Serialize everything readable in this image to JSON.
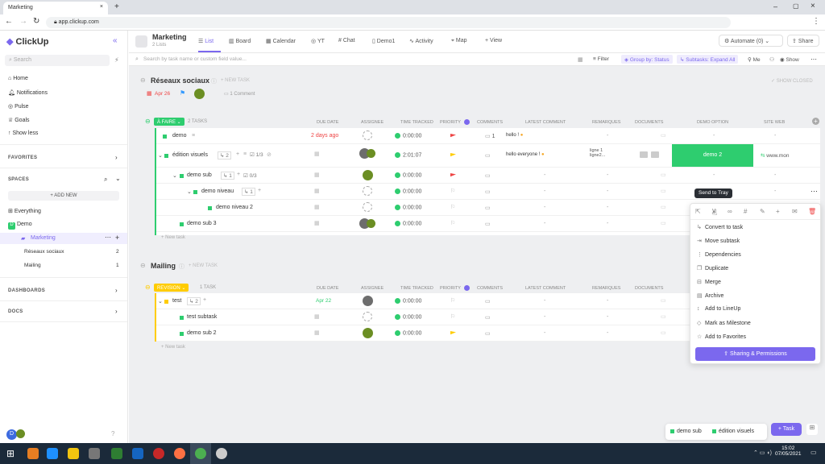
{
  "browser": {
    "tab_title": "Marketing",
    "url": "app.clickup.com"
  },
  "sidebar": {
    "brand": "ClickUp",
    "search_placeholder": "Search",
    "nav": [
      "Home",
      "Notifications",
      "Pulse",
      "Goals",
      "Show less"
    ],
    "favorites": "FAVORITES",
    "spaces": "SPACES",
    "add_new": "+ ADD NEW",
    "everything": "Everything",
    "demo": "Demo",
    "marketing": "Marketing",
    "lists": [
      {
        "label": "Réseaux sociaux",
        "count": "2"
      },
      {
        "label": "Mailing",
        "count": "1"
      }
    ],
    "dashboards": "DASHBOARDS",
    "docs": "DOCS",
    "user_initial": "D"
  },
  "header": {
    "title": "Marketing",
    "subtitle": "2 Lists",
    "tabs": [
      "List",
      "Board",
      "Calendar",
      "YT",
      "Chat",
      "Demo1",
      "Activity",
      "Map",
      "+ View"
    ],
    "automate": "Automate (0)",
    "share": "Share"
  },
  "filters": {
    "search_placeholder": "Search by task name or custom field value...",
    "filter": "Filter",
    "group": "Group by: Status",
    "subtasks": "Subtasks: Expand All",
    "me": "Me",
    "show": "Show"
  },
  "list1": {
    "title": "Réseaux sociaux",
    "new_task": "+ NEW TASK",
    "date": "Apr 26",
    "comment": "1 Comment",
    "show_closed": "SHOW CLOSED",
    "status": "À FAIRE",
    "count": "2 TASKS",
    "columns": [
      "DUE DATE",
      "ASSIGNEE",
      "TIME TRACKED",
      "PRIORITY",
      "COMMENTS",
      "LATEST COMMENT",
      "REMARQUES",
      "DOCUMENTS",
      "DEMO OPTION",
      "SITE WEB"
    ],
    "rows": [
      {
        "name": "demo",
        "due": "2 days ago",
        "time": "0:00:00",
        "comments": "1",
        "latest": "hello !",
        "remarques": "-",
        "option": "-",
        "site": "-"
      },
      {
        "name": "édition visuels",
        "sub": "2",
        "check": "1/3",
        "time": "2:01:07",
        "latest": "hello everyone !",
        "remarques": "ligne 1 ligne2...",
        "option": "demo 2",
        "site": "www.mon"
      },
      {
        "name": "demo sub",
        "sub": "1",
        "check": "0/3",
        "time": "0:00:00",
        "latest": "-",
        "remarques": "-",
        "option": "-",
        "site": "-"
      },
      {
        "name": "demo niveau",
        "sub": "1",
        "time": "0:00:00",
        "latest": "-",
        "remarques": "-",
        "option": "-",
        "site": "-"
      },
      {
        "name": "demo niveau 2",
        "time": "0:00:00",
        "latest": "-",
        "remarques": "-"
      },
      {
        "name": "demo sub 3",
        "time": "0:00:00",
        "latest": "-",
        "remarques": "-"
      }
    ],
    "new_task_row": "+ New task"
  },
  "list2": {
    "title": "Mailing",
    "new_task": "+ NEW TASK",
    "status": "REVISION",
    "count": "1 TASK",
    "rows": [
      {
        "name": "test",
        "sub": "2",
        "due": "Apr 22",
        "time": "0:00:00",
        "latest": "-",
        "remarques": "-"
      },
      {
        "name": "test subtask",
        "time": "0:00:00",
        "latest": "-",
        "remarques": "-"
      },
      {
        "name": "demo sub 2",
        "time": "0:00:00",
        "latest": "-",
        "remarques": "-"
      }
    ],
    "new_task_row": "+ New task"
  },
  "tooltip": "Send to Tray",
  "menu": {
    "items": [
      "Convert to task",
      "Move subtask",
      "Dependencies",
      "Duplicate",
      "Merge",
      "Archive",
      "Add to LineUp",
      "Mark as Milestone",
      "Add to Favorites"
    ],
    "sharing": "Sharing & Permissions"
  },
  "tray": {
    "items": [
      "demo sub",
      "édition visuels"
    ],
    "task_button": "+ Task"
  },
  "clock": {
    "time": "15:02",
    "date": "07/05/2021"
  },
  "colors": {
    "accent": "#7b68ee",
    "green": "#2ecd6f",
    "yellow": "#ffcc00"
  }
}
